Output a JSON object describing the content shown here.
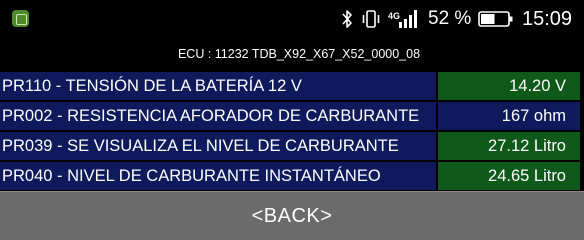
{
  "status_bar": {
    "icons": [
      "app-notification-icon",
      "bluetooth-icon",
      "vibrate-icon",
      "signal-icon",
      "battery-icon"
    ],
    "signal_label": "4G",
    "battery_percent": "52 %",
    "battery_level": 0.52,
    "time": "15:09"
  },
  "ecu": {
    "text": "ECU : 11232  TDB_X92_X67_X52_0000_08"
  },
  "parameters": [
    {
      "label": "PR110 - TENSIÓN DE LA BATERÍA 12 V",
      "value": "14.20 V",
      "value_color": "#0f5a1a"
    },
    {
      "label": "PR002 - RESISTENCIA AFORADOR DE CARBURANTE",
      "value": "167 ohm",
      "value_color": "#0f1a5c"
    },
    {
      "label": "PR039 - SE VISUALIZA EL NIVEL DE CARBURANTE",
      "value": "27.12 Litro",
      "value_color": "#0f5a1a"
    },
    {
      "label": "PR040 - NIVEL DE CARBURANTE INSTANTÁNEO",
      "value": "24.65 Litro",
      "value_color": "#0f5a1a"
    }
  ],
  "back_button": {
    "label": "<BACK>"
  },
  "colors": {
    "row_background": "#0f1a5c",
    "value_green": "#0f5a1a",
    "button_gray": "#6b6b6b"
  }
}
